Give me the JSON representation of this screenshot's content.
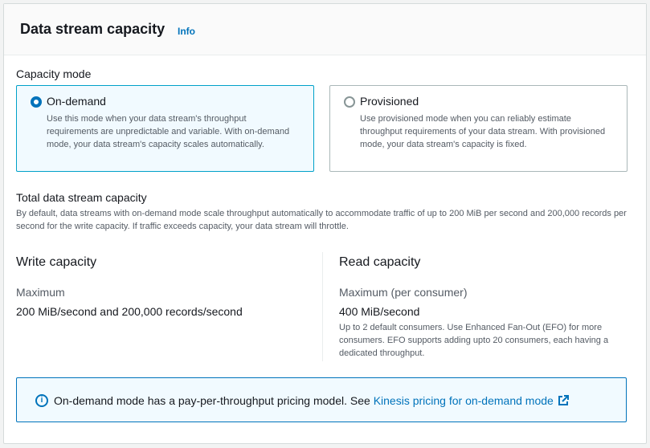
{
  "panel": {
    "title": "Data stream capacity",
    "info_label": "Info"
  },
  "capacity_mode": {
    "label": "Capacity mode",
    "selected": "On-demand",
    "options": [
      {
        "title": "On-demand",
        "description": "Use this mode when your data stream's throughput requirements are unpredictable and variable. With on-demand mode, your data stream's capacity scales automatically.",
        "checked": true
      },
      {
        "title": "Provisioned",
        "description": "Use provisioned mode when you can reliably estimate throughput requirements of your data stream. With provisioned mode, your data stream's capacity is fixed.",
        "checked": false
      }
    ]
  },
  "total": {
    "title": "Total data stream capacity",
    "description": "By default, data streams with on-demand mode scale throughput automatically to accommodate traffic of up to 200 MiB per second and 200,000 records per second for the write capacity. If traffic exceeds capacity, your data stream will throttle."
  },
  "write": {
    "title": "Write capacity",
    "key": "Maximum",
    "value": "200 MiB/second and 200,000 records/second"
  },
  "read": {
    "title": "Read capacity",
    "key": "Maximum (per consumer)",
    "value": "400 MiB/second",
    "note": "Up to 2 default consumers. Use Enhanced Fan-Out (EFO) for more consumers. EFO supports adding upto 20 consumers, each having a dedicated throughput."
  },
  "alert": {
    "icon": "info-icon",
    "text": "On-demand mode has a pay-per-throughput pricing model. See ",
    "link_text": "Kinesis pricing for on-demand mode",
    "link_icon": "external-link-icon"
  },
  "colors": {
    "accent": "#0073bb",
    "selected_tile_bg": "#f1faff",
    "selected_tile_border": "#00a1c9"
  }
}
